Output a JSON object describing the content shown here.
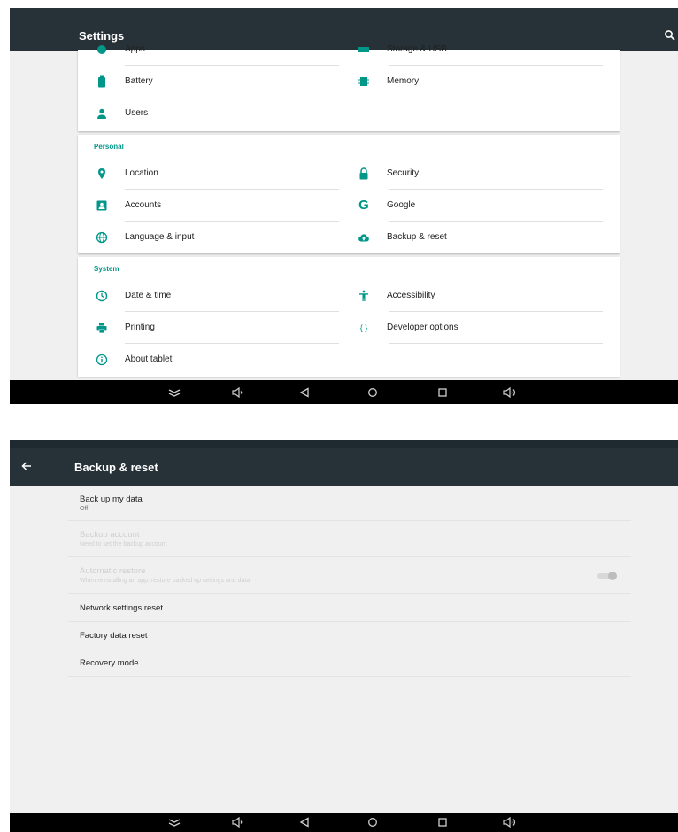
{
  "screen1": {
    "title": "Settings",
    "device_items": [
      {
        "left": "Apps",
        "right": "Storage & USB"
      },
      {
        "left": "Battery",
        "right": "Memory"
      },
      {
        "left": "Users"
      }
    ],
    "personal": {
      "header": "Personal",
      "items": [
        {
          "left": "Location",
          "right": "Security"
        },
        {
          "left": "Accounts",
          "right": "Google"
        },
        {
          "left": "Language & input",
          "right": "Backup & reset"
        }
      ]
    },
    "system": {
      "header": "System",
      "items": [
        {
          "left": "Date & time",
          "right": "Accessibility"
        },
        {
          "left": "Printing",
          "right": "Developer options"
        },
        {
          "left": "About tablet"
        }
      ]
    },
    "icons": {
      "google": "G",
      "developer": "{ }"
    },
    "accent_color": "#009688"
  },
  "screen2": {
    "title": "Backup & reset",
    "items": [
      {
        "title": "Back up my data",
        "subtitle": "Off"
      },
      {
        "title": "Backup account",
        "subtitle": "Need to set the backup account"
      },
      {
        "title": "Automatic restore",
        "subtitle": "When reinstalling an app, restore backed up settings and data",
        "toggle": "on-disabled"
      },
      {
        "title": "Network settings reset"
      },
      {
        "title": "Factory data reset"
      },
      {
        "title": "Recovery mode"
      }
    ]
  },
  "navbar_icons": [
    "hide-keyboard-icon",
    "volume-down-icon",
    "back-icon",
    "home-icon",
    "recents-icon",
    "volume-up-icon"
  ],
  "colors": {
    "appbar": "#263238",
    "navbar": "#000000",
    "accent": "#009688"
  }
}
